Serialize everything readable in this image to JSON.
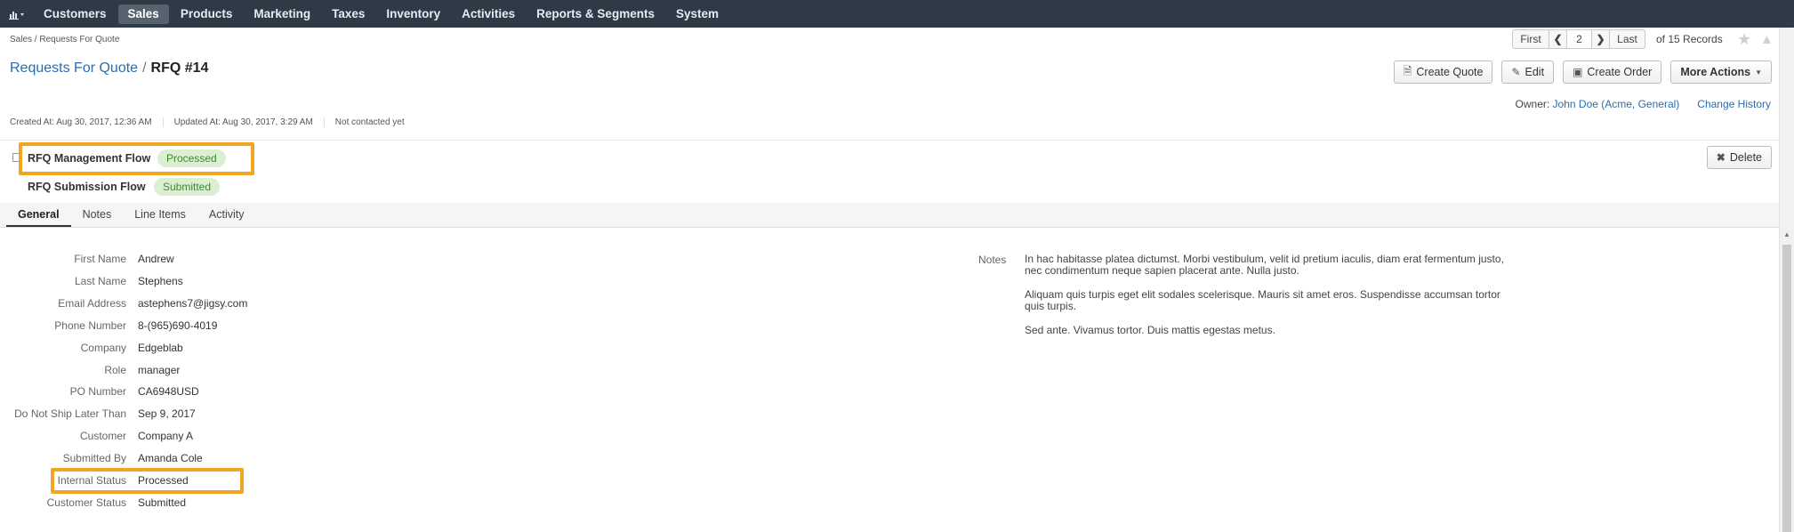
{
  "nav": {
    "items": [
      "Customers",
      "Sales",
      "Products",
      "Marketing",
      "Taxes",
      "Inventory",
      "Activities",
      "Reports & Segments",
      "System"
    ],
    "active_index": 1
  },
  "breadcrumb": "Sales / Requests For Quote",
  "pager": {
    "first": "First",
    "current": "2",
    "last": "Last",
    "records": "of 15 Records"
  },
  "title": {
    "parent": "Requests For Quote",
    "separator": "/",
    "current": "RFQ #14"
  },
  "actions": {
    "create_quote": "Create Quote",
    "edit": "Edit",
    "create_order": "Create Order",
    "more_actions": "More Actions"
  },
  "owner": {
    "label": "Owner:",
    "value": "John Doe (Acme, General)",
    "change_history": "Change History"
  },
  "meta": {
    "created": "Created At: Aug 30, 2017, 12:36 AM",
    "updated": "Updated At: Aug 30, 2017, 3:29 AM",
    "contacted": "Not contacted yet"
  },
  "workflows": [
    {
      "name": "RFQ Management Flow",
      "status": "Processed"
    },
    {
      "name": "RFQ Submission Flow",
      "status": "Submitted"
    }
  ],
  "delete_label": "Delete",
  "tabs": [
    "General",
    "Notes",
    "Line Items",
    "Activity"
  ],
  "fields": [
    {
      "label": "First Name",
      "value": "Andrew",
      "link": false
    },
    {
      "label": "Last Name",
      "value": "Stephens",
      "link": false
    },
    {
      "label": "Email Address",
      "value": "astephens7@jigsy.com",
      "link": true
    },
    {
      "label": "Phone Number",
      "value": "8-(965)690-4019",
      "link": false
    },
    {
      "label": "Company",
      "value": "Edgeblab",
      "link": false
    },
    {
      "label": "Role",
      "value": "manager",
      "link": false
    },
    {
      "label": "PO Number",
      "value": "CA6948USD",
      "link": false
    },
    {
      "label": "Do Not Ship Later Than",
      "value": "Sep 9, 2017",
      "link": false
    },
    {
      "label": "Customer",
      "value": "Company A",
      "link": true
    },
    {
      "label": "Submitted By",
      "value": "Amanda Cole",
      "link": true
    },
    {
      "label": "Internal Status",
      "value": "Processed",
      "link": false
    },
    {
      "label": "Customer Status",
      "value": "Submitted",
      "link": false
    }
  ],
  "notes": {
    "label": "Notes",
    "paragraphs": [
      "In hac habitasse platea dictumst. Morbi vestibulum, velit id pretium iaculis, diam erat fermentum justo, nec condimentum neque sapien placerat ante. Nulla justo.",
      "Aliquam quis turpis eget elit sodales scelerisque. Mauris sit amet eros. Suspendisse accumsan tortor quis turpis.",
      "Sed ante. Vivamus tortor. Duis mattis egestas metus."
    ]
  },
  "colors": {
    "nav_bg": "#2f3a47",
    "link": "#2b6cb0",
    "badge_bg": "#dcefd3",
    "badge_text": "#3d8a2e",
    "highlight": "#f0a623"
  }
}
